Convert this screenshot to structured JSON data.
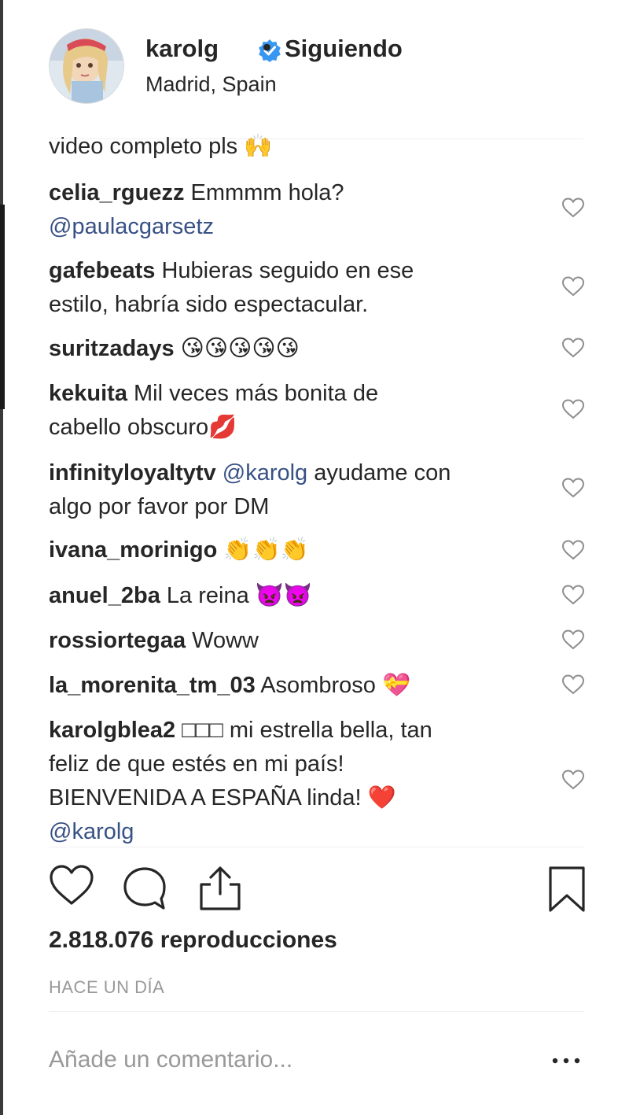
{
  "header": {
    "username": "karolg",
    "separator": "•",
    "follow_status": "Siguiendo",
    "location": "Madrid, Spain"
  },
  "comments": [
    {
      "user": "",
      "text": "video completo pls 🙌"
    },
    {
      "user": "celia_rguezz",
      "text": "Emmmm hola?",
      "mention": "@paulacgarsetz"
    },
    {
      "user": "gafebeats",
      "text": "Hubieras seguido en ese",
      "text2": "estilo, habría sido espectacular."
    },
    {
      "user": "suritzadays",
      "text": "😘😘😘😘😘"
    },
    {
      "user": "kekuita",
      "text": "Mil veces más bonita de",
      "text2": "cabello obscuro💋"
    },
    {
      "user": "infinityloyaltytv",
      "mention": "@karolg",
      "text": "ayudame con",
      "text2": "algo por favor por DM"
    },
    {
      "user": "ivana_morinigo",
      "text": "👏👏👏"
    },
    {
      "user": "anuel_2ba",
      "text": "La reina 👿👿"
    },
    {
      "user": "rossiortegaa",
      "text": "Woww"
    },
    {
      "user": "la_morenita_tm_03",
      "text": "Asombroso 💝"
    },
    {
      "user": "karolgblea2",
      "text": "□□□ mi estrella bella, tan",
      "text2": "feliz de que estés en mi país!",
      "text3": "BIENVENIDA A ESPAÑA linda! ❤️",
      "mention": "@karolg"
    }
  ],
  "stats": {
    "views": "2.818.076 reproducciones",
    "time_ago": "HACE UN DÍA"
  },
  "comment_box": {
    "placeholder": "Añade un comentario...",
    "more": "•••"
  },
  "icons": {
    "verified": "verified-badge-icon",
    "like": "heart-icon",
    "comment": "comment-bubble-icon",
    "share": "share-icon",
    "save": "bookmark-icon"
  },
  "colors": {
    "verified": "#3897f0",
    "mention": "#385185",
    "muted": "#999999"
  }
}
